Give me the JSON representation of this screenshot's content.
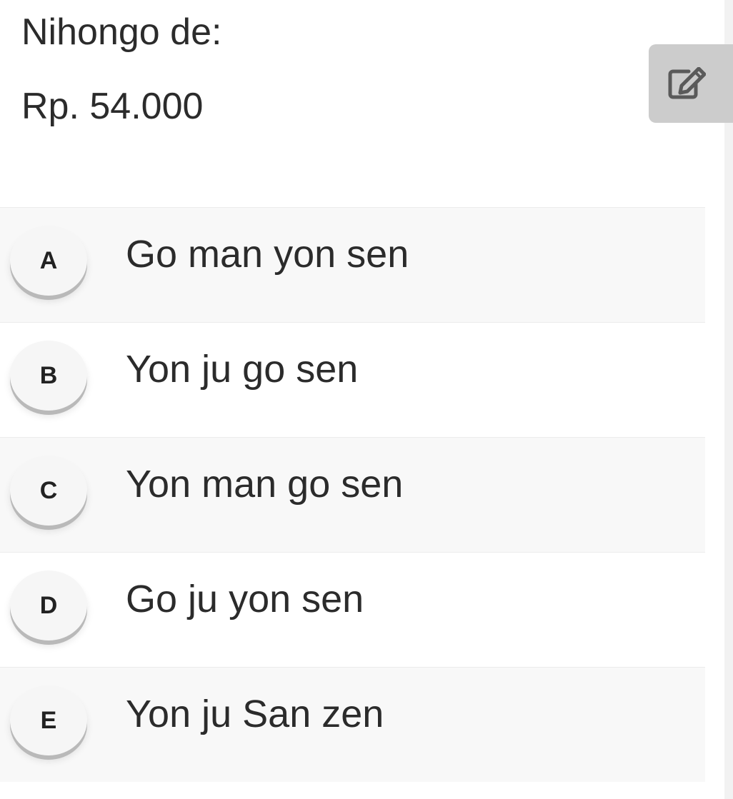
{
  "question": {
    "prompt": "Nihongo de:",
    "value": "Rp. 54.000"
  },
  "edit_button": {
    "icon": "edit-icon"
  },
  "options": [
    {
      "letter": "A",
      "text": "Go man yon sen"
    },
    {
      "letter": "B",
      "text": "Yon ju go sen"
    },
    {
      "letter": "C",
      "text": "Yon man go sen"
    },
    {
      "letter": "D",
      "text": "Go ju yon sen"
    },
    {
      "letter": "E",
      "text": "Yon ju San zen"
    }
  ],
  "colors": {
    "text": "#2b2b2b",
    "row_shaded": "#f8f8f8",
    "edit_button_bg": "#cccccc",
    "edit_icon": "#5a5a5a"
  }
}
